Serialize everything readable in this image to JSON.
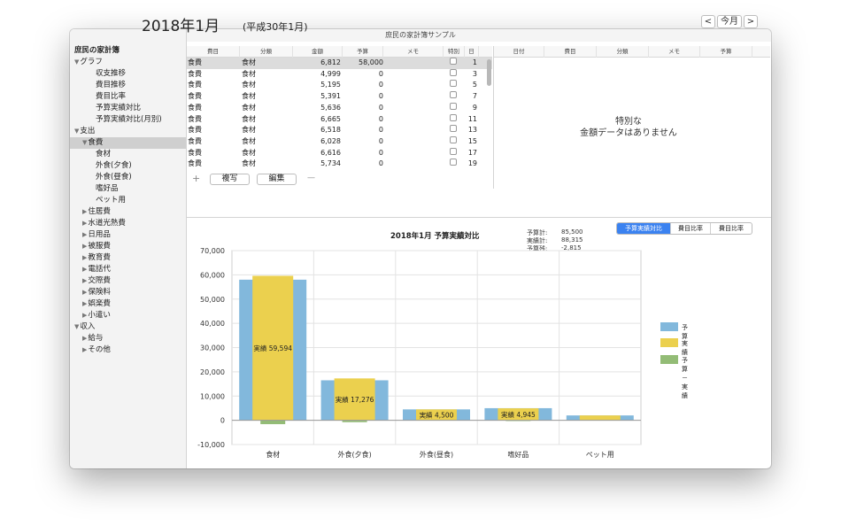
{
  "window": {
    "title": "庶民の家計簿サンプル"
  },
  "sidebar": {
    "items": [
      {
        "label": "庶民の家計簿",
        "level": 0,
        "tri": ""
      },
      {
        "label": "グラフ",
        "level": 0,
        "tri": "▼"
      },
      {
        "label": "収支推移",
        "level": 2,
        "tri": ""
      },
      {
        "label": "費目推移",
        "level": 2,
        "tri": ""
      },
      {
        "label": "費目比率",
        "level": 2,
        "tri": ""
      },
      {
        "label": "予算実績対比",
        "level": 2,
        "tri": ""
      },
      {
        "label": "予算実績対比(月別)",
        "level": 2,
        "tri": ""
      },
      {
        "label": "支出",
        "level": 0,
        "tri": "▼"
      },
      {
        "label": "食費",
        "level": 1,
        "tri": "▼",
        "selected": true
      },
      {
        "label": "食材",
        "level": 2,
        "tri": ""
      },
      {
        "label": "外食(夕食)",
        "level": 2,
        "tri": ""
      },
      {
        "label": "外食(昼食)",
        "level": 2,
        "tri": ""
      },
      {
        "label": "嗜好品",
        "level": 2,
        "tri": ""
      },
      {
        "label": "ペット用",
        "level": 2,
        "tri": ""
      },
      {
        "label": "住居費",
        "level": 1,
        "tri": "▶"
      },
      {
        "label": "水道光熱費",
        "level": 1,
        "tri": "▶"
      },
      {
        "label": "日用品",
        "level": 1,
        "tri": "▶"
      },
      {
        "label": "被服費",
        "level": 1,
        "tri": "▶"
      },
      {
        "label": "教育費",
        "level": 1,
        "tri": "▶"
      },
      {
        "label": "電話代",
        "level": 1,
        "tri": "▶"
      },
      {
        "label": "交際費",
        "level": 1,
        "tri": "▶"
      },
      {
        "label": "保険料",
        "level": 1,
        "tri": "▶"
      },
      {
        "label": "娯楽費",
        "level": 1,
        "tri": "▶"
      },
      {
        "label": "小遣い",
        "level": 1,
        "tri": "▶"
      },
      {
        "label": "収入",
        "level": 0,
        "tri": "▼"
      },
      {
        "label": "給与",
        "level": 1,
        "tri": "▶"
      },
      {
        "label": "その他",
        "level": 1,
        "tri": "▶"
      }
    ]
  },
  "header": {
    "date": "2018年1月",
    "era": "(平成30年1月)",
    "prev": "<",
    "today": "今月",
    "next": ">"
  },
  "left_table": {
    "columns": [
      "費目",
      "分類",
      "金額",
      "予算",
      "メモ",
      "特別",
      "日"
    ],
    "rows": [
      {
        "category": "食費",
        "sub": "食材",
        "amount": "6,812",
        "budget": "58,000",
        "memo": "",
        "day": "1"
      },
      {
        "category": "食費",
        "sub": "食材",
        "amount": "4,999",
        "budget": "0",
        "memo": "",
        "day": "3"
      },
      {
        "category": "食費",
        "sub": "食材",
        "amount": "5,195",
        "budget": "0",
        "memo": "",
        "day": "5"
      },
      {
        "category": "食費",
        "sub": "食材",
        "amount": "5,391",
        "budget": "0",
        "memo": "",
        "day": "7"
      },
      {
        "category": "食費",
        "sub": "食材",
        "amount": "5,636",
        "budget": "0",
        "memo": "",
        "day": "9"
      },
      {
        "category": "食費",
        "sub": "食材",
        "amount": "6,665",
        "budget": "0",
        "memo": "",
        "day": "11"
      },
      {
        "category": "食費",
        "sub": "食材",
        "amount": "6,518",
        "budget": "0",
        "memo": "",
        "day": "13"
      },
      {
        "category": "食費",
        "sub": "食材",
        "amount": "6,028",
        "budget": "0",
        "memo": "",
        "day": "15"
      },
      {
        "category": "食費",
        "sub": "食材",
        "amount": "6,616",
        "budget": "0",
        "memo": "",
        "day": "17"
      },
      {
        "category": "食費",
        "sub": "食材",
        "amount": "5,734",
        "budget": "0",
        "memo": "",
        "day": "19"
      }
    ]
  },
  "buttons": {
    "add": "+",
    "copy": "複写",
    "edit": "編集",
    "remove": "—"
  },
  "right_table": {
    "columns": [
      "日付",
      "費目",
      "分類",
      "メモ",
      "予算"
    ],
    "empty_line1": "特別な",
    "empty_line2": "金額データはありません"
  },
  "chart_tabs": [
    "予算実績対比",
    "費目比率",
    "費目比率"
  ],
  "summary": {
    "budget_label": "予算計:",
    "budget_value": "85,500",
    "actual_label": "実績計:",
    "actual_value": "88,315",
    "remain_label": "予算残:",
    "remain_value": "-2,815"
  },
  "colors": {
    "budget": "#82b8dc",
    "actual": "#ebd04e",
    "diff": "#93bc76",
    "accent": "#3b82f0"
  },
  "chart_data": {
    "type": "bar",
    "title": "2018年1月 予算実績対比",
    "categories": [
      "食材",
      "外食(夕食)",
      "外食(昼食)",
      "嗜好品",
      "ペット用"
    ],
    "series": [
      {
        "name": "予算",
        "values": [
          58000,
          16500,
          4500,
          5000,
          2000
        ]
      },
      {
        "name": "実績",
        "values": [
          59594,
          17276,
          4500,
          4945,
          2000
        ]
      },
      {
        "name": "予算－実績",
        "values": [
          -1594,
          -776,
          0,
          55,
          0
        ]
      }
    ],
    "data_labels": [
      "実績 59,594",
      "実績 17,276",
      "実績 4,500",
      "実績 4,945",
      ""
    ],
    "y_ticks": [
      "70,000",
      "60,000",
      "50,000",
      "40,000",
      "30,000",
      "20,000",
      "10,000",
      "0",
      "-10,000"
    ],
    "ylim": [
      -10000,
      70000
    ],
    "grid": true,
    "legend_position": "right"
  }
}
